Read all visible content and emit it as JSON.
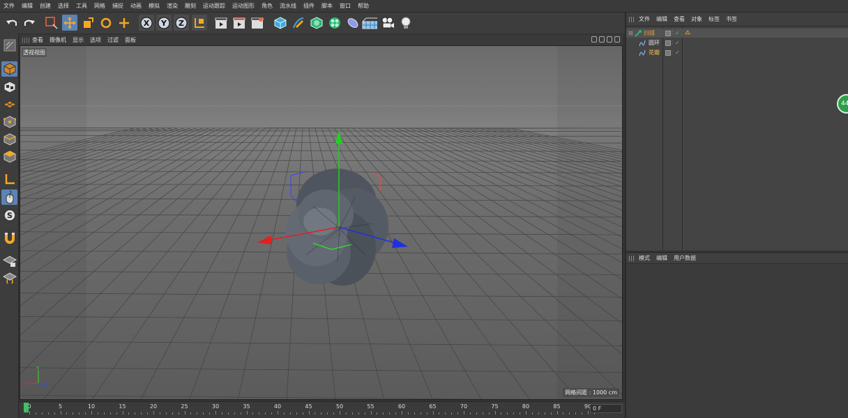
{
  "menubar": [
    "文件",
    "编辑",
    "创建",
    "选择",
    "工具",
    "网格",
    "捕捉",
    "动画",
    "模拟",
    "渲染",
    "雕刻",
    "运动跟踪",
    "运动图形",
    "角色",
    "流水线",
    "插件",
    "脚本",
    "窗口",
    "帮助"
  ],
  "toolbar": {
    "axis_x": "X",
    "axis_y": "Y",
    "axis_z": "Z"
  },
  "viewport": {
    "menu": [
      "查看",
      "摄像机",
      "显示",
      "选项",
      "过滤",
      "面板"
    ],
    "label": "透视视图",
    "grid_info": "网格间距 : 1000 cm",
    "axis_gizmo": {
      "x": "X",
      "y": "Y",
      "z": "Z"
    }
  },
  "object_manager": {
    "menu": [
      "文件",
      "编辑",
      "查看",
      "对象",
      "标签",
      "书签"
    ],
    "objects": [
      {
        "name": "扫描",
        "color": "#e8a040",
        "selected": true
      },
      {
        "name": "圆环",
        "color": "#e0e0e0",
        "selected": false
      },
      {
        "name": "花瓣",
        "color": "#f0c050",
        "selected": false
      }
    ]
  },
  "attribute_manager": {
    "menu": [
      "模式",
      "编辑",
      "用户数据"
    ]
  },
  "badge": "44",
  "timeline": {
    "ticks": [
      "0",
      "5",
      "10",
      "15",
      "20",
      "25",
      "30",
      "35",
      "40",
      "45",
      "50",
      "55",
      "60",
      "65",
      "70",
      "75",
      "80",
      "85",
      "90"
    ],
    "frame": "0 F"
  },
  "colors": {
    "accent": "#5b83b6",
    "x_axis": "#e02020",
    "y_axis": "#20d020",
    "z_axis": "#2030e0"
  }
}
